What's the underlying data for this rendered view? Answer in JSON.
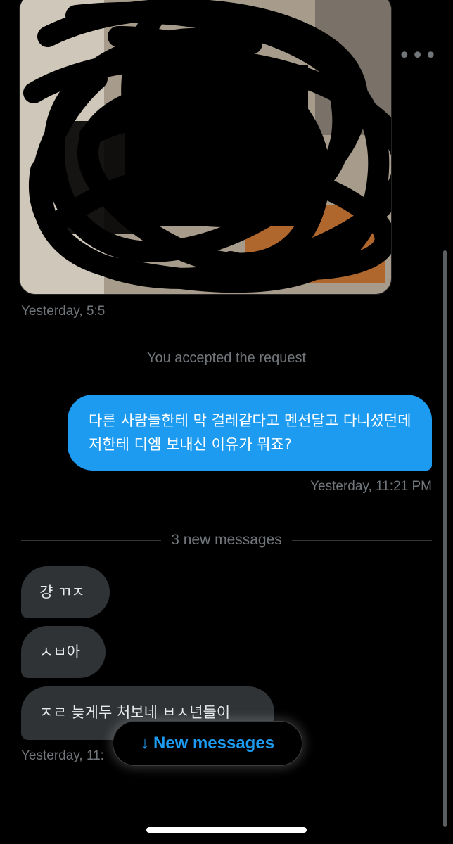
{
  "conversation": {
    "more_icon": "more-horizontal-icon",
    "photo": {
      "timestamp": "Yesterday, 5:5"
    },
    "system_note": "You accepted the request",
    "sent_message": {
      "text": "다른 사람들한테 막 걸레같다고 멘션달고 다니셨던데 저한테 디엠 보내신 이유가 뭐죠?",
      "timestamp": "Yesterday, 11:21 PM"
    },
    "new_messages_divider": "3 new messages",
    "received_messages": [
      {
        "text": "걍 ㄲㅈ"
      },
      {
        "text": "ㅅㅂ아"
      },
      {
        "text": "ㅈㄹ 늦게두 처보네 ㅂㅅ년들이"
      }
    ],
    "received_timestamp": "Yesterday, 11:"
  },
  "new_messages_button": {
    "arrow": "↓",
    "label": "New messages"
  },
  "colors": {
    "background": "#000000",
    "sent_bubble": "#1d9bf0",
    "received_bubble": "#2f3336",
    "muted_text": "#71767b",
    "accent": "#1d9bf0"
  }
}
